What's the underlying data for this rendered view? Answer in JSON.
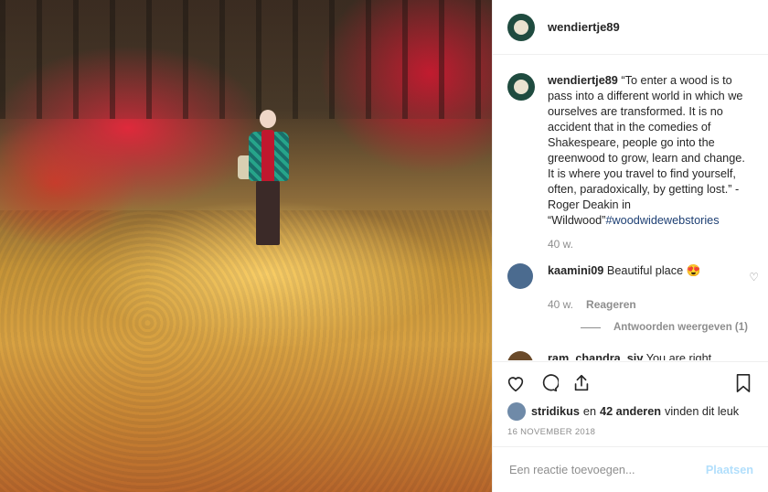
{
  "post": {
    "author": "wendiertje89",
    "caption": "“To enter a wood is to pass into a different world in which we ourselves are transformed. It is no accident that in the comedies of Shakespeare, people go into the greenwood to grow, learn and change. It is where you travel to find yourself, often, paradoxically, by getting lost.” - Roger Deakin in “Wildwood”",
    "hashtag": "#woodwidewebstories",
    "time": "40 w."
  },
  "comments": [
    {
      "user": "kaamini09",
      "text": "Beautiful place 😍",
      "time": "40 w.",
      "reply_label": "Reageren",
      "view_replies": "Antwoorden weergeven (1)",
      "liked": false
    },
    {
      "user": "ram_chandra_siv",
      "text": "You are right. This is where (Forests 🌳)the great",
      "liked": true
    }
  ],
  "likes": {
    "user": "stridikus",
    "connector": "en",
    "count_text": "42 anderen",
    "suffix": "vinden dit leuk"
  },
  "date": "16 NOVEMBER 2018",
  "add_comment": {
    "placeholder": "Een reactie toevoegen...",
    "post_label": "Plaatsen"
  },
  "icons": {
    "like": "heart-icon",
    "comment": "comment-bubble-icon",
    "share": "share-icon",
    "save": "bookmark-icon"
  },
  "colors": {
    "accent": "#ed4956",
    "hashtag": "#1d3f73",
    "muted": "#8e8e8e",
    "post_disabled": "#b2dffc"
  }
}
